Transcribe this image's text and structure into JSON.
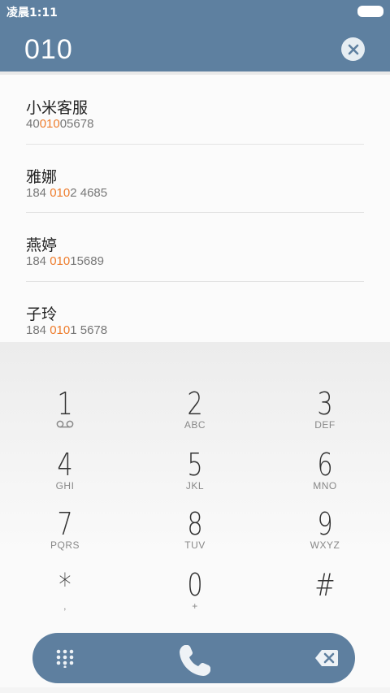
{
  "theme": {
    "header": "#5e80a0",
    "accent": "#ee7c2c",
    "bar": "#5e7f9f"
  },
  "status": {
    "time": "凌晨1:11"
  },
  "dialer": {
    "input": "010"
  },
  "results": [
    {
      "name": "小米客服",
      "num_pre": "40",
      "num_hl": "010",
      "num_post": "05678"
    },
    {
      "name": "雅娜",
      "num_pre": "184 ",
      "num_hl": "010",
      "num_post": "2 4685"
    },
    {
      "name": "燕婷",
      "num_pre": "184 ",
      "num_hl": "010",
      "num_post": "15689"
    },
    {
      "name": "子玲",
      "num_pre": "184 ",
      "num_hl": "010",
      "num_post": "1 5678"
    }
  ],
  "keys": [
    {
      "digit": "1",
      "letters": ""
    },
    {
      "digit": "2",
      "letters": "ABC"
    },
    {
      "digit": "3",
      "letters": "DEF"
    },
    {
      "digit": "4",
      "letters": "GHI"
    },
    {
      "digit": "5",
      "letters": "JKL"
    },
    {
      "digit": "6",
      "letters": "MNO"
    },
    {
      "digit": "7",
      "letters": "PQRS"
    },
    {
      "digit": "8",
      "letters": "TUV"
    },
    {
      "digit": "9",
      "letters": "WXYZ"
    },
    {
      "digit": "*",
      "letters": ","
    },
    {
      "digit": "0",
      "letters": "+"
    },
    {
      "digit": "#",
      "letters": ""
    }
  ],
  "icons": {
    "clear": "close-icon",
    "voicemail": "voicemail-icon",
    "keypad": "keypad-icon",
    "call": "phone-icon",
    "backspace": "backspace-icon"
  }
}
